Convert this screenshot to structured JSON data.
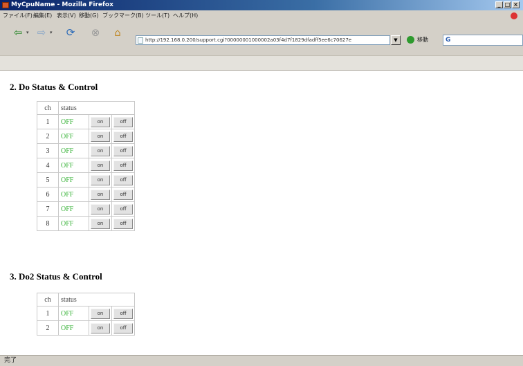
{
  "window": {
    "title": "MyCpuName - Mozilla Firefox"
  },
  "menu": [
    "ファイル(F)",
    "編集(E)",
    "表示(V)",
    "移動(G)",
    "ブックマーク(B)",
    "ツール(T)",
    "ヘルプ(H)"
  ],
  "toolbar": {
    "url": "http://192.168.0.200/support.cgi?00000001000002a03f4d7f1829dfadff5ee6c70627e",
    "go_label": "移動",
    "search_text": "G"
  },
  "sections": [
    {
      "title": "2. Do Status & Control",
      "header": {
        "ch": "ch",
        "status": "status"
      },
      "rows": [
        {
          "ch": "1",
          "status": "OFF",
          "on": "on",
          "off": "off"
        },
        {
          "ch": "2",
          "status": "OFF",
          "on": "on",
          "off": "off"
        },
        {
          "ch": "3",
          "status": "OFF",
          "on": "on",
          "off": "off"
        },
        {
          "ch": "4",
          "status": "OFF",
          "on": "on",
          "off": "off"
        },
        {
          "ch": "5",
          "status": "OFF",
          "on": "on",
          "off": "off"
        },
        {
          "ch": "6",
          "status": "OFF",
          "on": "on",
          "off": "off"
        },
        {
          "ch": "7",
          "status": "OFF",
          "on": "on",
          "off": "off"
        },
        {
          "ch": "8",
          "status": "OFF",
          "on": "on",
          "off": "off"
        }
      ]
    },
    {
      "title": "3. Do2 Status & Control",
      "header": {
        "ch": "ch",
        "status": "status"
      },
      "rows": [
        {
          "ch": "1",
          "status": "OFF",
          "on": "on",
          "off": "off"
        },
        {
          "ch": "2",
          "status": "OFF",
          "on": "on",
          "off": "off"
        }
      ]
    }
  ],
  "statusbar": {
    "text": "完了"
  },
  "colors": {
    "status_off": "#3cb43c",
    "titlebar": "#0a246a",
    "chrome": "#d4d0c8"
  },
  "icons": [
    "back-icon",
    "forward-icon",
    "reload-icon",
    "stop-icon",
    "home-icon",
    "page-icon",
    "go-icon",
    "google-icon"
  ]
}
